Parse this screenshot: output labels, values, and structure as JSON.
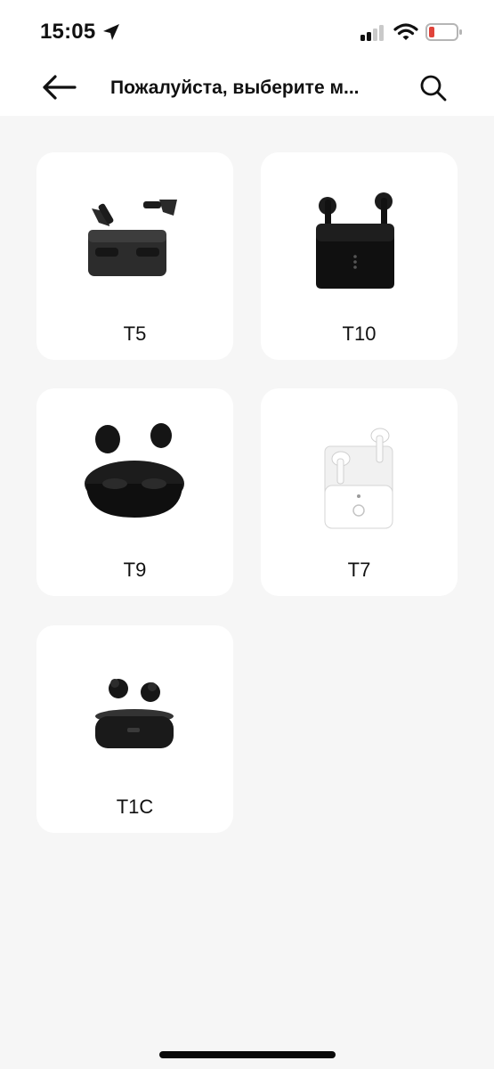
{
  "status_bar": {
    "time": "15:05",
    "icons": [
      "location-arrow-icon",
      "cellular-signal-icon",
      "wifi-icon",
      "battery-low-icon"
    ],
    "battery_color": "#e0433a"
  },
  "header": {
    "title": "Пожалуйста, выберите м...",
    "back_icon": "arrow-left-icon",
    "search_icon": "search-icon"
  },
  "models": [
    {
      "label": "T5",
      "image": "black-earbuds-open-case"
    },
    {
      "label": "T10",
      "image": "black-stem-earbuds-case"
    },
    {
      "label": "T9",
      "image": "black-round-earbuds-case"
    },
    {
      "label": "T7",
      "image": "white-stem-earbuds-case"
    },
    {
      "label": "T1C",
      "image": "black-compact-earbuds-case"
    }
  ],
  "colors": {
    "background": "#f6f6f6",
    "card": "#ffffff",
    "text": "#111111"
  }
}
